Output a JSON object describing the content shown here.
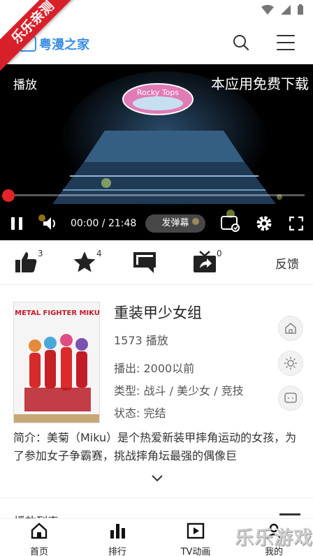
{
  "ribbon": {
    "text": "乐乐亲测"
  },
  "header": {
    "logo_text": "粤漫之家"
  },
  "player": {
    "label": "播放",
    "promo": "本应用免费下载",
    "time": "00:00 / 21:48",
    "danmaku_button": "发弹幕",
    "progress": 0.0,
    "art_title_sign": "Rocky Tops"
  },
  "actions": {
    "like_count": "3",
    "favorite_count": "4",
    "share_count": "0",
    "feedback_label": "反馈"
  },
  "anime": {
    "cover_title": "METAL FIGHTER MIKU",
    "title": "重装甲少女组",
    "plays": "1573 播放",
    "aired": "播出: 2000以前",
    "genres": "类型: 战斗 / 美少女 / 竞技",
    "status": "状态: 完结",
    "description": "简介：美菊（Miku）是个热爱新装甲摔角运动的女孩，为了参加女子争霸赛，挑战摔角坛最强的偶像巨"
  },
  "playlist": {
    "title": "播放列表"
  },
  "tabs": [
    {
      "label": "首页"
    },
    {
      "label": "排行"
    },
    {
      "label": "TV动画"
    },
    {
      "label": "我的"
    }
  ],
  "watermark": "乐乐游戏",
  "colors": {
    "accent": "#3a8ee6",
    "ribbon": "#d8202a",
    "progress_knob": "#e3242b"
  }
}
